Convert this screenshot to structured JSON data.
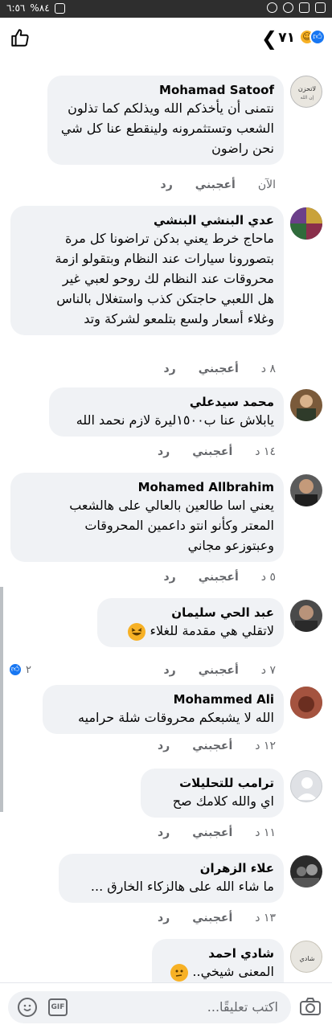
{
  "status_bar": {
    "time": "٦:٥٦",
    "battery": "%٨٤"
  },
  "header": {
    "reaction_count": "٧١",
    "like_icon": "thumbs-up-outline-icon",
    "back_icon": "chevron-left-icon"
  },
  "comments": [
    {
      "author": "Mohamad Satoof",
      "lines": [
        "نتمنى أن يأخذكم الله ويذلكم  كما تذلون",
        "الشعب وتستثمرونه ولينقطع عنا كل شي",
        "نحن راضون"
      ],
      "time": "الآن",
      "like": "أعجبني",
      "reply": "رد"
    },
    {
      "author": "عدي البنشي البنشي",
      "lines": [
        "ماحاج خرط يعني بدكن تراضونا كل مرة",
        "بتصورونا سيارات عند النظام وبتقولو ازمة",
        "محروقات عند النظام لك روحو لعبي غير",
        "هل اللعبي حاجتكن كذب واستغلال بالناس",
        "وغلاء أسعار ولسع بتلمعو لشركة وتد"
      ],
      "time": "٨ د",
      "like": "أعجبني",
      "reply": "رد"
    },
    {
      "author": "محمد سيدعلي",
      "lines": [
        "يابلاش عنا ب١٥٠٠ليرة لازم نحمد الله"
      ],
      "time": "١٤ د",
      "like": "أعجبني",
      "reply": "رد"
    },
    {
      "author": "Mohamed Allbrahim",
      "lines": [
        "يعني اسا طالعين بالعالي على هالشعب",
        "المعتر  وكأنو  انتو داعمين المحروقات",
        "وعبتوزعو مجاني"
      ],
      "time": "٥ د",
      "like": "أعجبني",
      "reply": "رد"
    },
    {
      "author": "عبد الحي سليمان",
      "lines": [
        "لاتقلي هي مقدمة للغلاء"
      ],
      "time": "٧ د",
      "like": "أعجبني",
      "reply": "رد",
      "reactions": "٢"
    },
    {
      "author": "Mohammed Ali",
      "lines": [
        "الله لا يشبعكم محروقات شلة حراميه"
      ],
      "time": "١٢ د",
      "like": "أعجبني",
      "reply": "رد"
    },
    {
      "author": "ترامب للتحليلات",
      "lines": [
        "اي والله كلامك صح"
      ],
      "time": "١١ د",
      "like": "أعجبني",
      "reply": "رد"
    },
    {
      "author": "علاء الزهران",
      "lines": [
        "ما شاء الله على هالزكاء الخارق ..."
      ],
      "time": "١٣ د",
      "like": "أعجبني",
      "reply": "رد"
    },
    {
      "author": "شادي احمد",
      "lines": [
        "المعنى شيخي.."
      ],
      "time": "",
      "like": "",
      "reply": ""
    }
  ],
  "composer": {
    "placeholder": "اكتب تعليقًا...",
    "gif_label": "GIF"
  },
  "colors": {
    "bubble": "#f0f2f5",
    "like_blue": "#1877f2",
    "meta_gray": "#65676b"
  }
}
